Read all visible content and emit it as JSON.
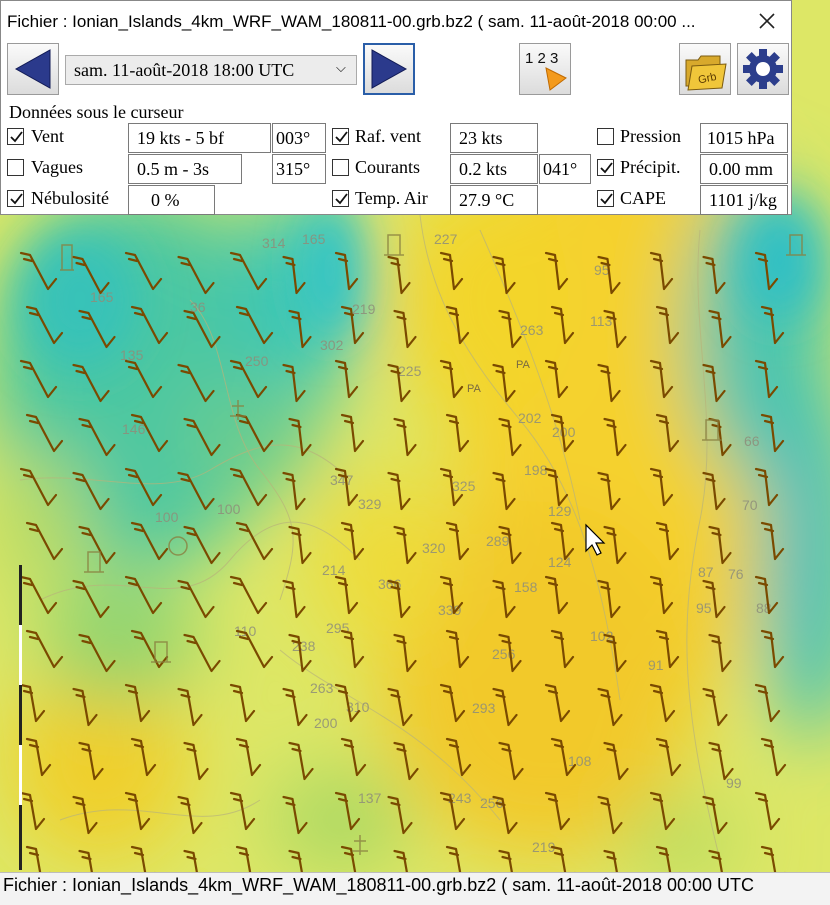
{
  "window": {
    "title": "Fichier : Ionian_Islands_4km_WRF_WAM_180811-00.grb.bz2 ( sam. 11-août-2018 00:00  ..."
  },
  "toolbar": {
    "date_value": "sam. 11-août-2018 18:00  UTC",
    "grb_icon_text": "Grb",
    "numbers_icon_text": "1 2 3"
  },
  "panel": {
    "section_title": "Données sous le curseur",
    "rows": [
      {
        "label": "Vent",
        "checked": true,
        "value": "19 kts -  5 bf",
        "extra": "003°"
      },
      {
        "label": "Vagues",
        "checked": false,
        "value": "0.5 m - 3s",
        "extra": "315°"
      },
      {
        "label": "Nébulosité",
        "checked": true,
        "value": "0 %"
      },
      {
        "label": "Raf. vent",
        "checked": true,
        "value": "23 kts"
      },
      {
        "label": "Courants",
        "checked": false,
        "value": "0.2 kts",
        "extra": "041°"
      },
      {
        "label": "Temp. Air",
        "checked": true,
        "value": "27.9 °C"
      },
      {
        "label": "Pression",
        "checked": false,
        "value": "1015 hPa"
      },
      {
        "label": "Précipit.",
        "checked": true,
        "value": "0.00 mm"
      },
      {
        "label": "CAPE",
        "checked": true,
        "value": "1101 j/kg"
      }
    ]
  },
  "map": {
    "depth_labels": [
      "314",
      "165",
      "227",
      "95",
      "113",
      "165",
      "36",
      "219",
      "263",
      "135",
      "250",
      "302",
      "225",
      "146",
      "202",
      "200",
      "347",
      "329",
      "325",
      "198",
      "100",
      "100",
      "129",
      "70",
      "66",
      "320",
      "289",
      "124",
      "214",
      "366",
      "158",
      "87",
      "76",
      "295",
      "339",
      "95",
      "88",
      "110",
      "238",
      "256",
      "102",
      "91",
      "263",
      "200",
      "310",
      "293",
      "108",
      "137",
      "243",
      "256",
      "99",
      "219"
    ],
    "nav_marks": [
      "PA",
      "PA"
    ]
  },
  "status_bar": {
    "text": "Fichier : Ionian_Islands_4km_WRF_WAM_180811-00.grb.bz2 ( sam. 11-août-2018 00:00  UTC"
  },
  "colors": {
    "accent_blue": "#2a5ea8",
    "arrow_brown": "#7a4a00",
    "map_yellow": "#f2dc2e",
    "map_cyan": "#3ec8b8"
  },
  "icons": [
    "close-icon",
    "prev-arrow-icon",
    "next-arrow-icon",
    "chevron-down-icon",
    "numbers-icon",
    "grb-folder-icon",
    "gear-icon",
    "check-icon",
    "mouse-cursor-icon"
  ]
}
